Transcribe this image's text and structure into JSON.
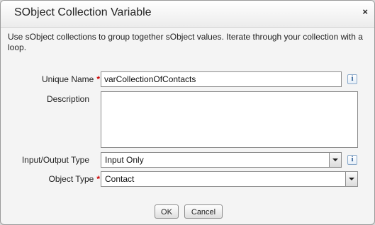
{
  "dialog": {
    "title": "SObject Collection Variable",
    "intro": "Use sObject collections to group together sObject values. Iterate through your collection with a loop."
  },
  "icons": {
    "close": "close-icon",
    "info": "info-icon",
    "close_glyph": "×",
    "info_glyph": "i",
    "required_glyph": "*"
  },
  "form": {
    "unique_name_label": "Unique Name",
    "unique_name_value": "varCollectionOfContacts",
    "description_label": "Description",
    "description_value": "",
    "io_type_label": "Input/Output Type",
    "io_type_value": "Input Only",
    "object_type_label": "Object Type",
    "object_type_value": "Contact"
  },
  "buttons": {
    "ok": "OK",
    "cancel": "Cancel"
  },
  "colors": {
    "required": "#cc0000",
    "info": "#1a4f8b"
  }
}
